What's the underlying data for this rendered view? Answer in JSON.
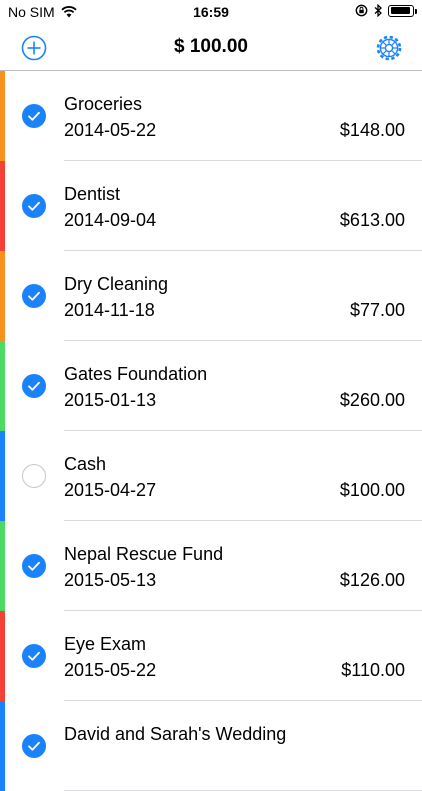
{
  "status_bar": {
    "carrier": "No SIM",
    "time": "16:59"
  },
  "nav": {
    "title": "$ 100.00",
    "add_icon": "plus-circle-icon",
    "settings_icon": "gear-icon",
    "accent_color": "#1a82fb"
  },
  "items": [
    {
      "name": "Groceries",
      "date": "2014-05-22",
      "amount": "$148.00",
      "checked": true,
      "color": "#f7921e"
    },
    {
      "name": "Dentist",
      "date": "2014-09-04",
      "amount": "$613.00",
      "checked": true,
      "color": "#f44336"
    },
    {
      "name": "Dry Cleaning",
      "date": "2014-11-18",
      "amount": "$77.00",
      "checked": true,
      "color": "#f7921e"
    },
    {
      "name": "Gates Foundation",
      "date": "2015-01-13",
      "amount": "$260.00",
      "checked": true,
      "color": "#4cd964"
    },
    {
      "name": "Cash",
      "date": "2015-04-27",
      "amount": "$100.00",
      "checked": false,
      "color": "#1a82fb"
    },
    {
      "name": "Nepal Rescue Fund",
      "date": "2015-05-13",
      "amount": "$126.00",
      "checked": true,
      "color": "#4cd964"
    },
    {
      "name": "Eye Exam",
      "date": "2015-05-22",
      "amount": "$110.00",
      "checked": true,
      "color": "#f44336"
    },
    {
      "name": "David and Sarah's Wedding",
      "date": "",
      "amount": "",
      "checked": true,
      "color": "#1a82fb"
    }
  ]
}
